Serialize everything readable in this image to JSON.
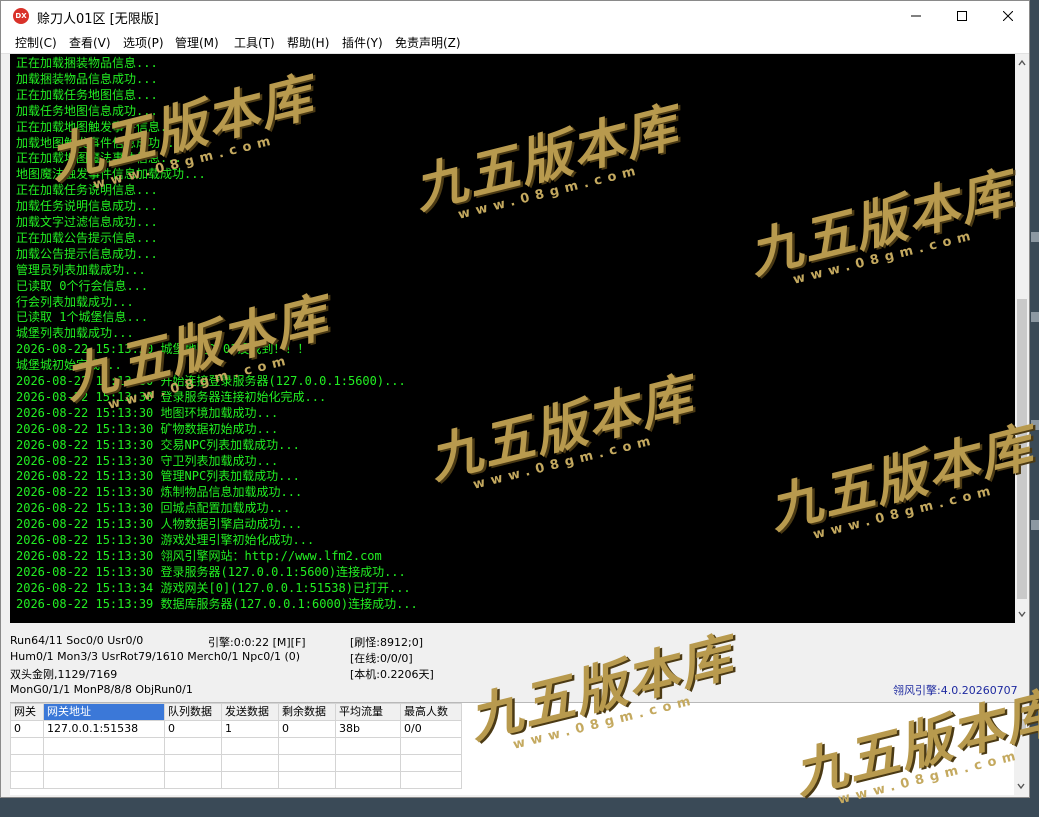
{
  "window": {
    "app_icon": "DX",
    "title": "赊刀人01区 [无限版]",
    "controls": [
      "minimize-icon",
      "maximize-icon",
      "close-icon"
    ]
  },
  "menu": [
    "控制(C)",
    "查看(V)",
    "选项(P)",
    "管理(M)",
    "工具(T)",
    "帮助(H)",
    "插件(Y)",
    "免责声明(Z)"
  ],
  "console_lines": [
    "正在加载捆装物品信息...",
    "加载捆装物品信息成功...",
    "正在加载任务地图信息...",
    "加载任务地图信息成功...",
    "正在加载地图触发事件信息...",
    "加载地图触发事件信息成功...",
    "正在加载地图魔法事件信息...",
    "地图魔法触发事件信息加载成功...",
    "正在加载任务说明信息...",
    "加载任务说明信息成功...",
    "加载文字过滤信息成功...",
    "正在加载公告提示信息...",
    "加载公告提示信息成功...",
    "管理员列表加载成功...",
    "已读取 0个行会信息...",
    "行会列表加载成功...",
    "已读取 1个城堡信息...",
    "城堡列表加载成功...",
    "2026-08-22 15:13:30 城堡地图D701没找到！！！",
    "城堡城初始完成...",
    "2026-08-22 15:13:30 开始连接登录服务器(127.0.0.1:5600)...",
    "2026-08-22 15:13:30 登录服务器连接初始化完成...",
    "2026-08-22 15:13:30 地图环境加载成功...",
    "2026-08-22 15:13:30 矿物数据初始成功...",
    "2026-08-22 15:13:30 交易NPC列表加载成功...",
    "2026-08-22 15:13:30 守卫列表加载成功...",
    "2026-08-22 15:13:30 管理NPC列表加载成功...",
    "2026-08-22 15:13:30 炼制物品信息加载成功...",
    "2026-08-22 15:13:30 回城点配置加载成功...",
    "2026-08-22 15:13:30 人物数据引擎启动成功...",
    "2026-08-22 15:13:30 游戏处理引擎初始化成功...",
    "2026-08-22 15:13:30 翎风引擎网站：http://www.lfm2.com",
    "2026-08-22 15:13:30 登录服务器(127.0.0.1:5600)连接成功...",
    "2026-08-22 15:13:34 游戏网关[0](127.0.0.1:51538)已打开...",
    "2026-08-22 15:13:39 数据库服务器(127.0.0.1:6000)连接成功..."
  ],
  "status": {
    "run": "Run64/11 Soc0/0 Usr0/0",
    "engine_time": "引擎:0:0:22 [M][F]",
    "refresh": "[刷怪:8912;0]",
    "hum": "Hum0/1 Mon3/3 UsrRot79/1610 Merch0/1 Npc0/1 (0)",
    "online": "[在线:0/0/0]",
    "item": "双头金刚,1129/7169",
    "local": "[本机:0.2206天]",
    "mon": "MonG0/1/1 MonP8/8/8 ObjRun0/1",
    "engine_version": "翎风引擎:4.0.20260707"
  },
  "gateway_table": {
    "columns": [
      "网关",
      "网关地址",
      "队列数据",
      "发送数据",
      "剩余数据",
      "平均流量",
      "最高人数"
    ],
    "rows": [
      [
        "0",
        "127.0.0.1:51538",
        "0",
        "1",
        "0",
        "38b",
        "0/0"
      ]
    ]
  },
  "watermark": {
    "logo_text": "九五版本库",
    "url_text": "www.08gm.com"
  }
}
